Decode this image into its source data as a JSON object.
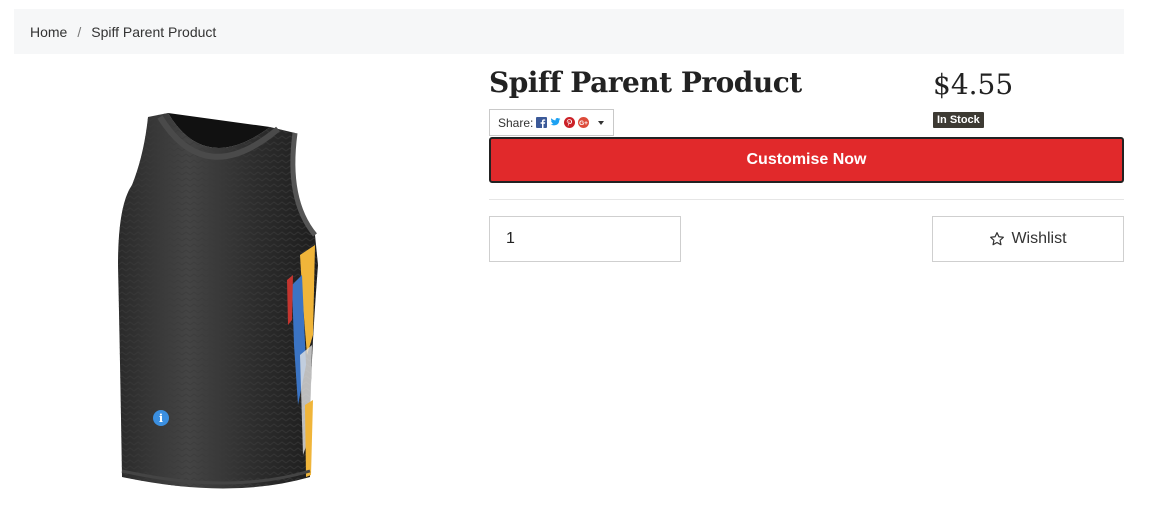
{
  "breadcrumb": {
    "home": "Home",
    "separator": "/",
    "current": "Spiff Parent Product"
  },
  "product": {
    "title": "Spiff Parent Product",
    "price": "$4.55",
    "stock_status": "In Stock",
    "image_icon": "basketball-jersey"
  },
  "share": {
    "label": "Share:",
    "icons": [
      "facebook-icon",
      "twitter-icon",
      "pinterest-icon",
      "google-plus-icon"
    ]
  },
  "actions": {
    "customise_label": "Customise Now",
    "quantity_value": "1",
    "wishlist_label": "Wishlist"
  },
  "colors": {
    "customise_bg": "#e1292b",
    "stock_badge_bg": "#3d3a33",
    "breadcrumb_bg": "#f6f7f8"
  }
}
